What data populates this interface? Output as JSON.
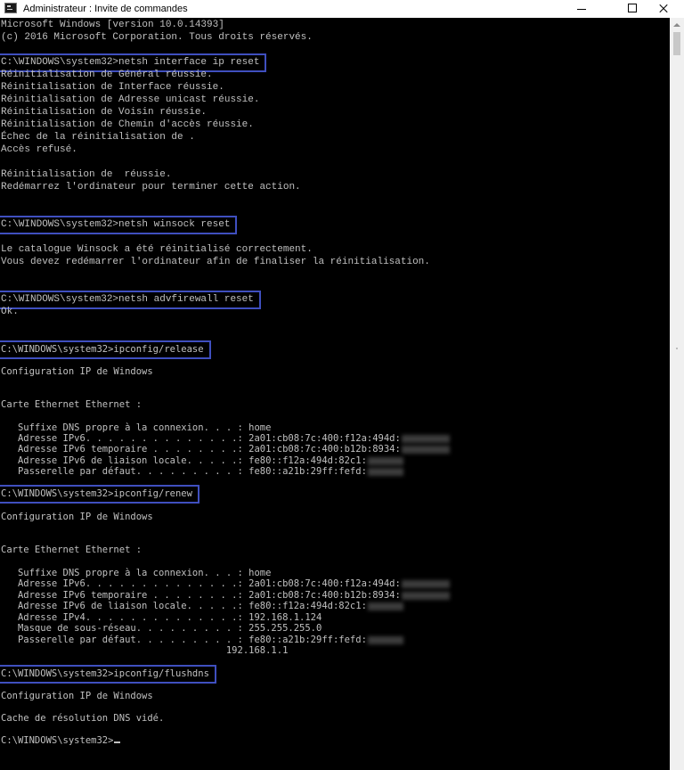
{
  "window": {
    "title": "Administrateur : Invite de commandes"
  },
  "console": {
    "lines": [
      {
        "text": "Microsoft Windows [version 10.0.14393]"
      },
      {
        "text": "(c) 2016 Microsoft Corporation. Tous droits réservés."
      },
      {
        "text": "C:\\WINDOWS\\system32>netsh interface ip reset"
      },
      {
        "text": "Réinitialisation de Général réussie."
      },
      {
        "text": "Réinitialisation de Interface réussie."
      },
      {
        "text": "Réinitialisation de Adresse unicast réussie."
      },
      {
        "text": "Réinitialisation de Voisin réussie."
      },
      {
        "text": "Réinitialisation de Chemin d'accès réussie."
      },
      {
        "text": "Échec de la réinitialisation de ."
      },
      {
        "text": "Accès refusé."
      },
      {
        "text": "Réinitialisation de  réussie."
      },
      {
        "text": "Redémarrez l'ordinateur pour terminer cette action."
      },
      {
        "text": "C:\\WINDOWS\\system32>netsh winsock reset"
      },
      {
        "text": "Le catalogue Winsock a été réinitialisé correctement."
      },
      {
        "text": "Vous devez redémarrer l'ordinateur afin de finaliser la réinitialisation."
      },
      {
        "text": "C:\\WINDOWS\\system32>netsh advfirewall reset"
      },
      {
        "text": "Ok."
      },
      {
        "text": "C:\\WINDOWS\\system32>ipconfig/release"
      },
      {
        "text": "Configuration IP de Windows"
      },
      {
        "text": "Carte Ethernet Ethernet :"
      },
      {
        "text": "   Suffixe DNS propre à la connexion. . . : home"
      },
      {
        "text": "   Adresse IPv6. . . . . . . . . . . . . .: 2a01:cb08:7c:400:f12a:494d:"
      },
      {
        "text": "   Adresse IPv6 temporaire . . . . . . . .: 2a01:cb08:7c:400:b12b:8934:"
      },
      {
        "text": "   Adresse IPv6 de liaison locale. . . . .: fe80::f12a:494d:82c1:"
      },
      {
        "text": "   Passerelle par défaut. . . . . . . . . : fe80::a21b:29ff:fefd:"
      },
      {
        "text": "C:\\WINDOWS\\system32>ipconfig/renew"
      },
      {
        "text": "Configuration IP de Windows"
      },
      {
        "text": "Carte Ethernet Ethernet :"
      },
      {
        "text": "   Suffixe DNS propre à la connexion. . . : home"
      },
      {
        "text": "   Adresse IPv6. . . . . . . . . . . . . .: 2a01:cb08:7c:400:f12a:494d:"
      },
      {
        "text": "   Adresse IPv6 temporaire . . . . . . . .: 2a01:cb08:7c:400:b12b:8934:"
      },
      {
        "text": "   Adresse IPv6 de liaison locale. . . . .: fe80::f12a:494d:82c1:"
      },
      {
        "text": "   Adresse IPv4. . . . . . . . . . . . . .: 192.168.1.124"
      },
      {
        "text": "   Masque de sous-réseau. . . . . . . . . : 255.255.255.0"
      },
      {
        "text": "   Passerelle par défaut. . . . . . . . . : fe80::a21b:29ff:fefd:"
      },
      {
        "text": "                                        192.168.1.1"
      },
      {
        "text": "C:\\WINDOWS\\system32>ipconfig/flushdns"
      },
      {
        "text": "Configuration IP de Windows"
      },
      {
        "text": "Cache de résolution DNS vidé."
      },
      {
        "text": "C:\\WINDOWS\\system32>"
      }
    ]
  }
}
